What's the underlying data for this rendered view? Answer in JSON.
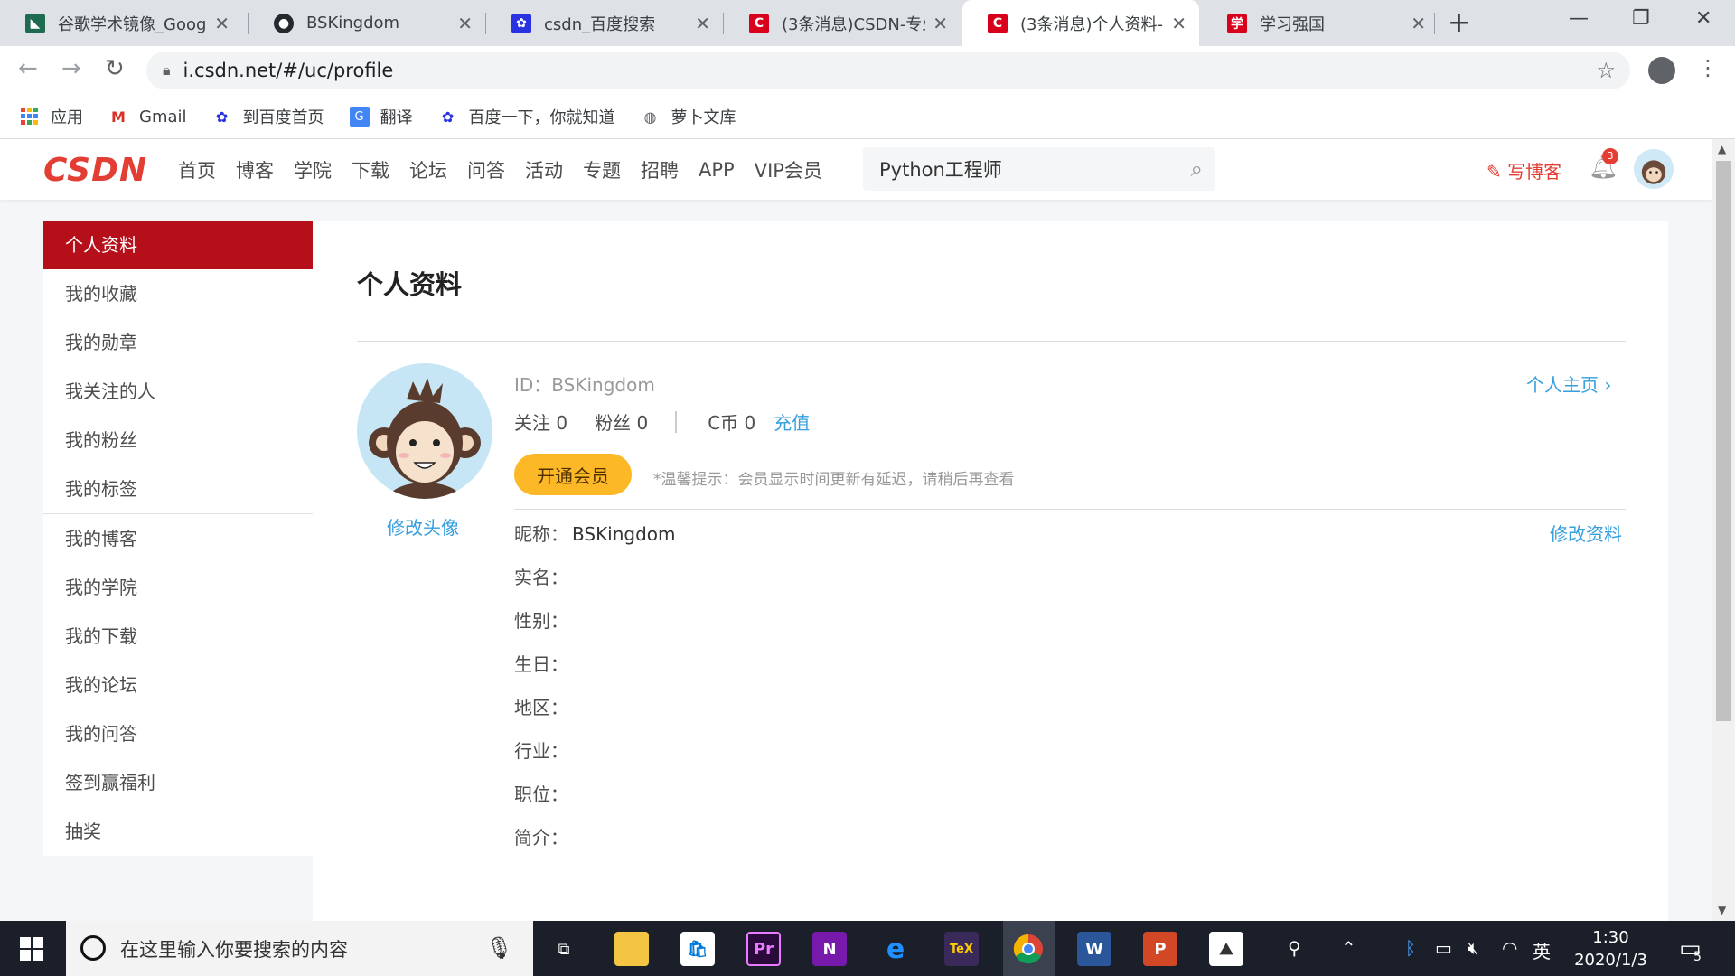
{
  "browser": {
    "tabs": [
      {
        "title": "谷歌学术镜像_Goog",
        "favicon_color": "#1e6b52",
        "active": false
      },
      {
        "title": "BSKingdom",
        "favicon_color": "#24292e",
        "active": false
      },
      {
        "title": "csdn_百度搜索",
        "favicon_color": "#2932e1",
        "active": false
      },
      {
        "title": "(3条消息)CSDN-专业",
        "favicon_color": "#d9001b",
        "active": false
      },
      {
        "title": "(3条消息)个人资料-",
        "favicon_color": "#d9001b",
        "active": true
      },
      {
        "title": "学习强国",
        "favicon_color": "#d9001b",
        "active": false
      }
    ],
    "address": "i.csdn.net/#/uc/profile",
    "bookmarks": [
      {
        "label": "应用",
        "icon": "apps-grid-icon"
      },
      {
        "label": "Gmail",
        "icon": "gmail-icon"
      },
      {
        "label": "到百度首页",
        "icon": "baidu-paw-icon"
      },
      {
        "label": "翻译",
        "icon": "translate-icon"
      },
      {
        "label": "百度一下，你就知道",
        "icon": "baidu-paw-icon"
      },
      {
        "label": "萝卜文库",
        "icon": "globe-icon"
      }
    ]
  },
  "header": {
    "logo": "CSDN",
    "nav": [
      "首页",
      "博客",
      "学院",
      "下载",
      "论坛",
      "问答",
      "活动",
      "专题",
      "招聘",
      "APP",
      "VIP会员"
    ],
    "search_value": "Python工程师",
    "write_blog": "写博客",
    "notification_count": "3",
    "brand_color": "#e33e33"
  },
  "sidebar": {
    "group1": [
      "个人资料",
      "我的收藏",
      "我的勋章",
      "我关注的人",
      "我的粉丝",
      "我的标签"
    ],
    "group2": [
      "我的博客",
      "我的学院",
      "我的下载",
      "我的论坛",
      "我的问答",
      "签到赢福利",
      "抽奖"
    ],
    "active_color": "#b5101a"
  },
  "profile": {
    "title": "个人资料",
    "id_line": "ID：BSKingdom",
    "following": "关注 0",
    "fans": "粉丝 0",
    "coins": "C币 0",
    "recharge": "充值",
    "homepage_link": "个人主页",
    "vip_button": "开通会员",
    "vip_tip": "*温馨提示：会员显示时间更新有延迟，请稍后再查看",
    "edit_avatar": "修改头像",
    "edit_profile": "修改资料",
    "fields": [
      {
        "label": "昵称：",
        "value": "BSKingdom"
      },
      {
        "label": "实名：",
        "value": ""
      },
      {
        "label": "性别：",
        "value": ""
      },
      {
        "label": "生日：",
        "value": ""
      },
      {
        "label": "地区：",
        "value": ""
      },
      {
        "label": "行业：",
        "value": ""
      },
      {
        "label": "职位：",
        "value": ""
      },
      {
        "label": "简介：",
        "value": ""
      }
    ],
    "link_color": "#349edf"
  },
  "taskbar": {
    "search_placeholder": "在这里输入你要搜索的内容",
    "time": "1:30",
    "date": "2020/1/3",
    "ime": "英",
    "notification_count": "5"
  }
}
